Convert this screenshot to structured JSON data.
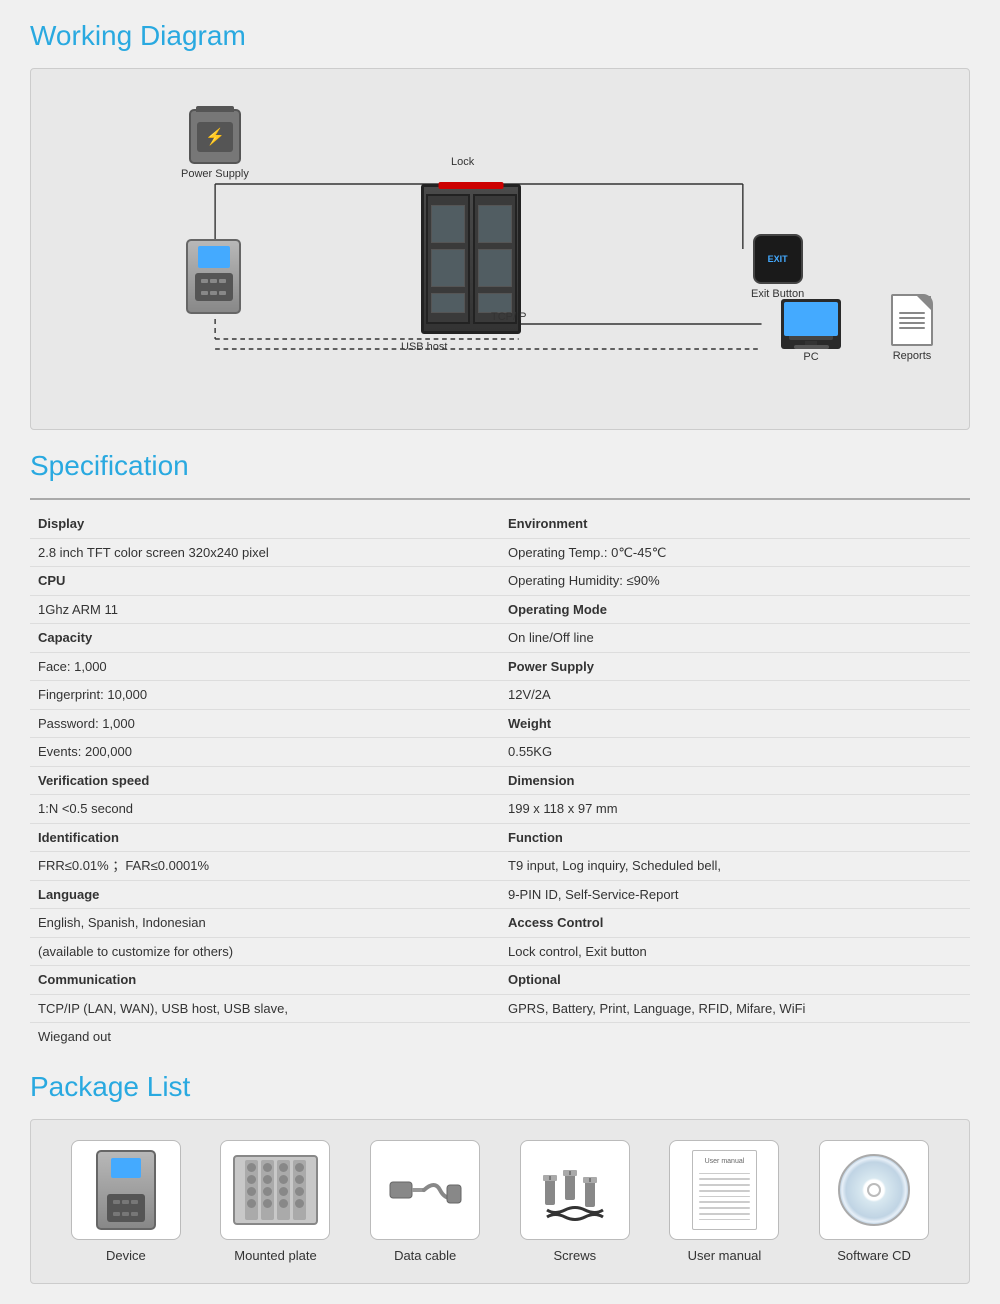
{
  "workingDiagram": {
    "title": "Working Diagram",
    "items": {
      "powerSupply": "Power Supply",
      "lock": "Lock",
      "exitButton": "Exit Button",
      "pc": "PC",
      "reports": "Reports",
      "tcpip": "TCP/IP",
      "usbHost": "USB host"
    }
  },
  "specification": {
    "title": "Specification",
    "rows": [
      {
        "leftLabel": "Display",
        "leftValue": "2.8 inch TFT color screen 320x240 pixel",
        "rightLabel": "Environment",
        "rightValue": "Operating Temp.: 0℃-45℃"
      },
      {
        "leftLabel": "",
        "leftValue": "",
        "rightLabel": "",
        "rightValue": "Operating Humidity: ≤90%"
      },
      {
        "leftLabel": "CPU",
        "leftValue": "1Ghz ARM 11",
        "rightLabel": "Operating Mode",
        "rightValue": "On line/Off line"
      },
      {
        "leftLabel": "Capacity",
        "leftValue": "Face: 1,000",
        "rightLabel": "Power Supply",
        "rightValue": "12V/2A"
      },
      {
        "leftLabel": "",
        "leftValue": "Fingerprint:  10,000",
        "rightLabel": "Weight",
        "rightValue": "0.55KG"
      },
      {
        "leftLabel": "",
        "leftValue": "Password: 1,000",
        "rightLabel": "Dimension",
        "rightValue": "199 x 118 x 97 mm"
      },
      {
        "leftLabel": "",
        "leftValue": "Events:  200,000",
        "rightLabel": "Function",
        "rightValue": "T9 input, Log inquiry, Scheduled bell,"
      },
      {
        "leftLabel": "Verification speed",
        "leftValue": "1:N <0.5 second",
        "rightLabel": "",
        "rightValue": "9-PIN ID, Self-Service-Report"
      },
      {
        "leftLabel": "Identification",
        "leftValue": "FRR≤0.01% ；FAR≤0.0001%",
        "rightLabel": "Access Control",
        "rightValue": "Lock control, Exit button"
      },
      {
        "leftLabel": "Language",
        "leftValue": "English, Spanish, Indonesian",
        "rightLabel": "Optional",
        "rightValue": "GPRS, Battery,  Print, Language, RFID, Mifare, WiFi"
      },
      {
        "leftLabel": "",
        "leftValue": "(available to customize for others)",
        "rightLabel": "",
        "rightValue": ""
      },
      {
        "leftLabel": "Communication",
        "leftValue": "TCP/IP (LAN, WAN), USB host, USB slave,",
        "rightLabel": "",
        "rightValue": ""
      },
      {
        "leftLabel": "",
        "leftValue": "Wiegand out",
        "rightLabel": "",
        "rightValue": ""
      }
    ]
  },
  "packageList": {
    "title": "Package List",
    "items": [
      {
        "label": "Device"
      },
      {
        "label": "Mounted plate"
      },
      {
        "label": "Data cable"
      },
      {
        "label": "Screws"
      },
      {
        "label": "User manual"
      },
      {
        "label": "Software CD"
      }
    ]
  }
}
